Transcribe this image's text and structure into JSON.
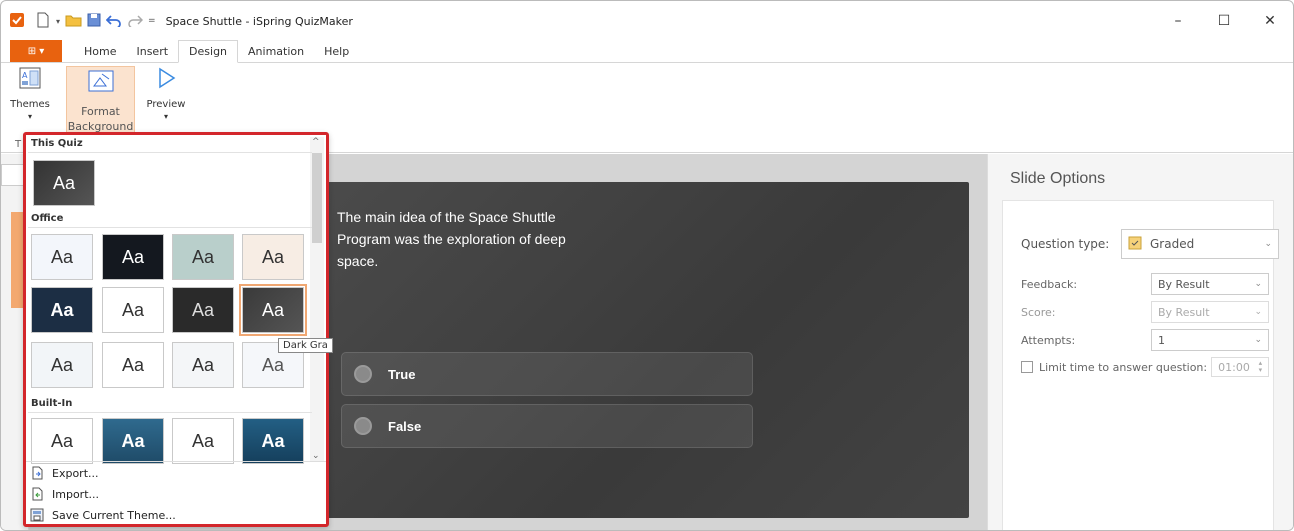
{
  "window": {
    "title": "Space Shuttle - iSpring QuizMaker",
    "minimize_label": "–",
    "maximize_label": "☐",
    "close_label": "✕"
  },
  "menu": {
    "file_label": "⊞ ▾",
    "tabs": [
      "Home",
      "Insert",
      "Design",
      "Animation",
      "Help"
    ],
    "active_tab": "Design"
  },
  "ribbon": {
    "themes_label": "Themes",
    "format_background_label_1": "Format",
    "format_background_label_2": "Background",
    "preview_label": "Preview",
    "dropdown_arrow": "▾",
    "group_label_stub": "T"
  },
  "theme_dropdown": {
    "section_this_quiz": "This Quiz",
    "section_office": "Office",
    "section_builtin": "Built-In",
    "thumb_text": "Aa",
    "export_label": "Export...",
    "import_label": "Import...",
    "save_label": "Save Current Theme...",
    "tooltip": "Dark Gra",
    "scroll_up": "^",
    "scroll_down": "⌄"
  },
  "slide": {
    "question": "The main idea of the Space Shuttle Program was the exploration of deep space.",
    "answers": [
      "True",
      "False"
    ]
  },
  "slide_options": {
    "title": "Slide Options",
    "question_type_label": "Question type:",
    "question_type_value": "Graded",
    "feedback_label": "Feedback:",
    "feedback_value": "By Result",
    "score_label": "Score:",
    "score_value": "By Result",
    "attempts_label": "Attempts:",
    "attempts_value": "1",
    "limit_time_label": "Limit time to answer question:",
    "limit_time_value": "01:00"
  },
  "colors": {
    "accent_orange": "#e8620f",
    "highlight_red": "#d3262b",
    "slide_bg": "#444444"
  }
}
